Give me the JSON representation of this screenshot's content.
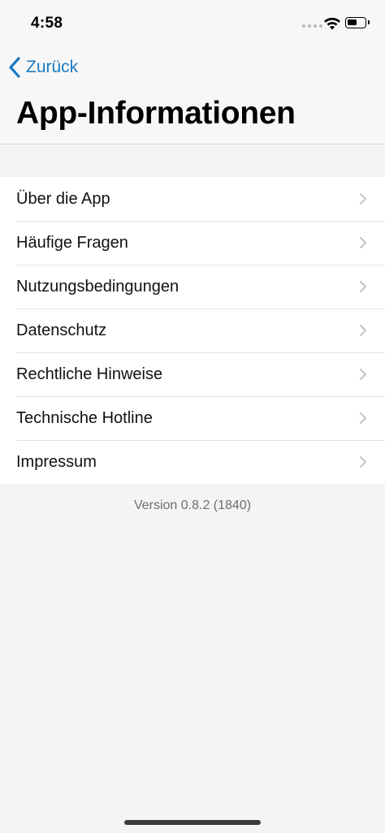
{
  "status_bar": {
    "time": "4:58",
    "battery_level_fraction": 0.6
  },
  "navigation": {
    "back_label": "Zurück",
    "title": "App-Informationen"
  },
  "list": {
    "items": [
      {
        "label": "Über die App"
      },
      {
        "label": "Häufige Fragen"
      },
      {
        "label": "Nutzungsbedingungen"
      },
      {
        "label": "Datenschutz"
      },
      {
        "label": "Rechtliche Hinweise"
      },
      {
        "label": "Technische Hotline"
      },
      {
        "label": "Impressum"
      }
    ]
  },
  "footer": {
    "version": "Version 0.8.2 (1840)"
  },
  "colors": {
    "accent": "#1a7cc4",
    "background": "#f4f4f4",
    "chevron": "#c4c4c7"
  }
}
